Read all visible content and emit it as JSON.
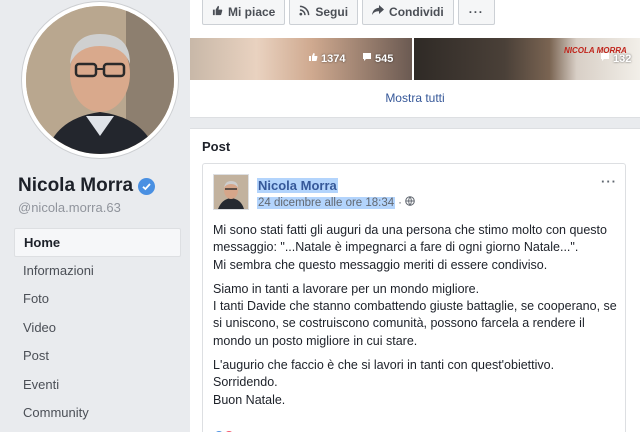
{
  "profile": {
    "name": "Nicola Morra",
    "handle": "@nicola.morra.63"
  },
  "nav": {
    "items": [
      {
        "label": "Home",
        "active": true
      },
      {
        "label": "Informazioni"
      },
      {
        "label": "Foto"
      },
      {
        "label": "Video"
      },
      {
        "label": "Post"
      },
      {
        "label": "Eventi"
      },
      {
        "label": "Community"
      }
    ]
  },
  "actions": {
    "like": "Mi piace",
    "follow": "Segui",
    "share": "Condividi",
    "more": "···"
  },
  "photos": {
    "stats": [
      {
        "likes": "1374",
        "comments": "545"
      },
      {
        "comments": "132"
      }
    ],
    "sticker_text": "NICOLA MORRA",
    "show_all": "Mostra tutti"
  },
  "posts_section": {
    "title": "Post"
  },
  "post": {
    "author": "Nicola Morra",
    "date": "24 dicembre alle ore 18:34",
    "separator": "·",
    "menu": "···",
    "paragraphs": [
      "Mi sono stati fatti gli auguri da una persona che stimo molto con questo messaggio: \"...Natale è impegnarci a fare di ogni giorno Natale...\".\nMi sembra che questo messaggio meriti di essere condiviso.",
      "Siamo in tanti a lavorare per un mondo migliore.\nI tanti Davide che stanno combattendo giuste battaglie, se cooperano, se si uniscono, se costruiscono comunità, possono farcela a rendere il mondo un posto migliore in cui stare.",
      "L'augurio che faccio è che si lavori in tanti con quest'obiettivo.\nSorridendo.\nBuon Natale."
    ]
  },
  "colors": {
    "link": "#365899",
    "selection": "#b3d4fc",
    "verified": "#4a90e2"
  }
}
